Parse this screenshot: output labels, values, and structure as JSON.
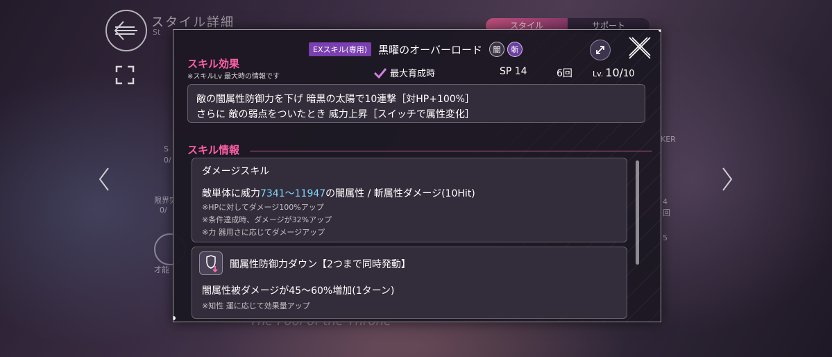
{
  "background": {
    "screen_title": "スタイル詳細",
    "screen_subtitle": "St",
    "tabs": [
      "スタイル",
      "サポート"
    ],
    "side_labels": [
      "S",
      "0/",
      "限界突",
      "0/",
      "才能",
      "KER",
      "4",
      "回",
      "5"
    ],
    "footer_text": "The Fool of the Throne"
  },
  "dialog": {
    "ex_badge": "EXスキル(専用)",
    "skill_name": "黒曜のオーバーロード",
    "attributes": [
      "闇",
      "斬"
    ],
    "effect_title": "スキル効果",
    "effect_note": "※スキルLv 最大時の情報です",
    "max_growth_label": "最大育成時",
    "sp": "SP 14",
    "uses": "6回",
    "lv_prefix": "Lv.",
    "lv_value": "10/",
    "lv_max": "10",
    "effect_text_1": "敵の闇属性防御力を下げ 暗黒の太陽で10連撃［対HP+100%］",
    "effect_text_2": "さらに 敵の弱点をついたとき 威力上昇［スイッチで属性変化］",
    "info_title": "スキル情報",
    "damage": {
      "title": "ダメージスキル",
      "line_prefix": "敵単体に威力",
      "power": "7341〜11947",
      "line_suffix": "の闇属性 / 斬属性ダメージ(10Hit)",
      "notes": [
        "※HPに対してダメージ100%アップ",
        "※条件達成時、ダメージが32%アップ",
        "※力 器用さに応じてダメージアップ"
      ]
    },
    "debuff": {
      "title": "闇属性防御力ダウン【2つまで同時発動】",
      "line": "闇属性被ダメージが45〜60%増加(1ターン)",
      "note": "※知性 運に応じて効果量アップ"
    }
  },
  "colors": {
    "accent_pink": "#ff5fa8",
    "highlight_blue": "#7fd8ff",
    "ex_badge": "#7a3fb0"
  }
}
